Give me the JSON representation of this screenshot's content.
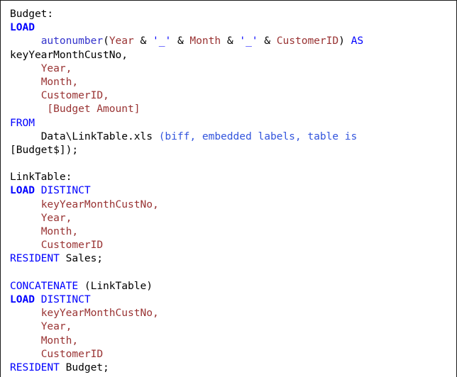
{
  "editor": {
    "name": "load-script-listing",
    "language": "QlikView Load Script",
    "colors": {
      "background": "#ffffff",
      "border": "#1a1a1a",
      "plain": "#000000",
      "keyword": "#0000ff",
      "keyword_bold": "#0000ff",
      "function": "#3333cc",
      "field": "#993333",
      "string": "#0000ff",
      "option": "#3355dd"
    }
  },
  "lines": [
    {
      "id": "line-1",
      "tokens": [
        {
          "text": "Budget:",
          "style": "plain"
        }
      ]
    },
    {
      "id": "line-2",
      "tokens": [
        {
          "text": "LOAD",
          "style": "keyword_bold"
        }
      ]
    },
    {
      "id": "line-3",
      "tokens": [
        {
          "text": "     ",
          "style": "plain"
        },
        {
          "text": "autonumber",
          "style": "function"
        },
        {
          "text": "(",
          "style": "plain"
        },
        {
          "text": "Year",
          "style": "field"
        },
        {
          "text": " & ",
          "style": "plain"
        },
        {
          "text": "'_'",
          "style": "string"
        },
        {
          "text": " & ",
          "style": "plain"
        },
        {
          "text": "Month",
          "style": "field"
        },
        {
          "text": " & ",
          "style": "plain"
        },
        {
          "text": "'_'",
          "style": "string"
        },
        {
          "text": " & ",
          "style": "plain"
        },
        {
          "text": "CustomerID",
          "style": "field"
        },
        {
          "text": ") ",
          "style": "plain"
        },
        {
          "text": "AS",
          "style": "keyword"
        }
      ]
    },
    {
      "id": "line-4",
      "tokens": [
        {
          "text": "keyYearMonthCustNo,",
          "style": "plain"
        }
      ]
    },
    {
      "id": "line-5",
      "tokens": [
        {
          "text": "     ",
          "style": "plain"
        },
        {
          "text": "Year,",
          "style": "field"
        }
      ]
    },
    {
      "id": "line-6",
      "tokens": [
        {
          "text": "     ",
          "style": "plain"
        },
        {
          "text": "Month,",
          "style": "field"
        }
      ]
    },
    {
      "id": "line-7",
      "tokens": [
        {
          "text": "     ",
          "style": "plain"
        },
        {
          "text": "CustomerID,",
          "style": "field"
        }
      ]
    },
    {
      "id": "line-8",
      "tokens": [
        {
          "text": "      ",
          "style": "plain"
        },
        {
          "text": "[Budget Amount]",
          "style": "field"
        }
      ]
    },
    {
      "id": "line-9",
      "tokens": [
        {
          "text": "FROM",
          "style": "keyword"
        }
      ]
    },
    {
      "id": "line-10",
      "tokens": [
        {
          "text": "     ",
          "style": "plain"
        },
        {
          "text": "Data\\LinkTable.xls ",
          "style": "plain"
        },
        {
          "text": "(biff, embedded labels, table is",
          "style": "option"
        }
      ]
    },
    {
      "id": "line-11",
      "tokens": [
        {
          "text": "[Budget$]);",
          "style": "plain"
        }
      ]
    },
    {
      "id": "line-12",
      "tokens": [
        {
          "text": "",
          "style": "plain"
        }
      ]
    },
    {
      "id": "line-13",
      "tokens": [
        {
          "text": "LinkTable:",
          "style": "plain"
        }
      ]
    },
    {
      "id": "line-14",
      "tokens": [
        {
          "text": "LOAD",
          "style": "keyword_bold"
        },
        {
          "text": " ",
          "style": "plain"
        },
        {
          "text": "DISTINCT",
          "style": "keyword"
        }
      ]
    },
    {
      "id": "line-15",
      "tokens": [
        {
          "text": "     ",
          "style": "plain"
        },
        {
          "text": "keyYearMonthCustNo,",
          "style": "field"
        }
      ]
    },
    {
      "id": "line-16",
      "tokens": [
        {
          "text": "     ",
          "style": "plain"
        },
        {
          "text": "Year,",
          "style": "field"
        }
      ]
    },
    {
      "id": "line-17",
      "tokens": [
        {
          "text": "     ",
          "style": "plain"
        },
        {
          "text": "Month,",
          "style": "field"
        }
      ]
    },
    {
      "id": "line-18",
      "tokens": [
        {
          "text": "     ",
          "style": "plain"
        },
        {
          "text": "CustomerID",
          "style": "field"
        }
      ]
    },
    {
      "id": "line-19",
      "tokens": [
        {
          "text": "RESIDENT",
          "style": "keyword"
        },
        {
          "text": " Sales;",
          "style": "plain"
        }
      ]
    },
    {
      "id": "line-20",
      "tokens": [
        {
          "text": "",
          "style": "plain"
        }
      ]
    },
    {
      "id": "line-21",
      "tokens": [
        {
          "text": "CONCATENATE",
          "style": "keyword"
        },
        {
          "text": " (LinkTable)",
          "style": "plain"
        }
      ]
    },
    {
      "id": "line-22",
      "tokens": [
        {
          "text": "LOAD",
          "style": "keyword_bold"
        },
        {
          "text": " ",
          "style": "plain"
        },
        {
          "text": "DISTINCT",
          "style": "keyword"
        }
      ]
    },
    {
      "id": "line-23",
      "tokens": [
        {
          "text": "     ",
          "style": "plain"
        },
        {
          "text": "keyYearMonthCustNo,",
          "style": "field"
        }
      ]
    },
    {
      "id": "line-24",
      "tokens": [
        {
          "text": "     ",
          "style": "plain"
        },
        {
          "text": "Year,",
          "style": "field"
        }
      ]
    },
    {
      "id": "line-25",
      "tokens": [
        {
          "text": "     ",
          "style": "plain"
        },
        {
          "text": "Month,",
          "style": "field"
        }
      ]
    },
    {
      "id": "line-26",
      "tokens": [
        {
          "text": "     ",
          "style": "plain"
        },
        {
          "text": "CustomerID",
          "style": "field"
        }
      ]
    },
    {
      "id": "line-27",
      "tokens": [
        {
          "text": "RESIDENT",
          "style": "keyword"
        },
        {
          "text": " Budget;",
          "style": "plain"
        }
      ]
    }
  ]
}
